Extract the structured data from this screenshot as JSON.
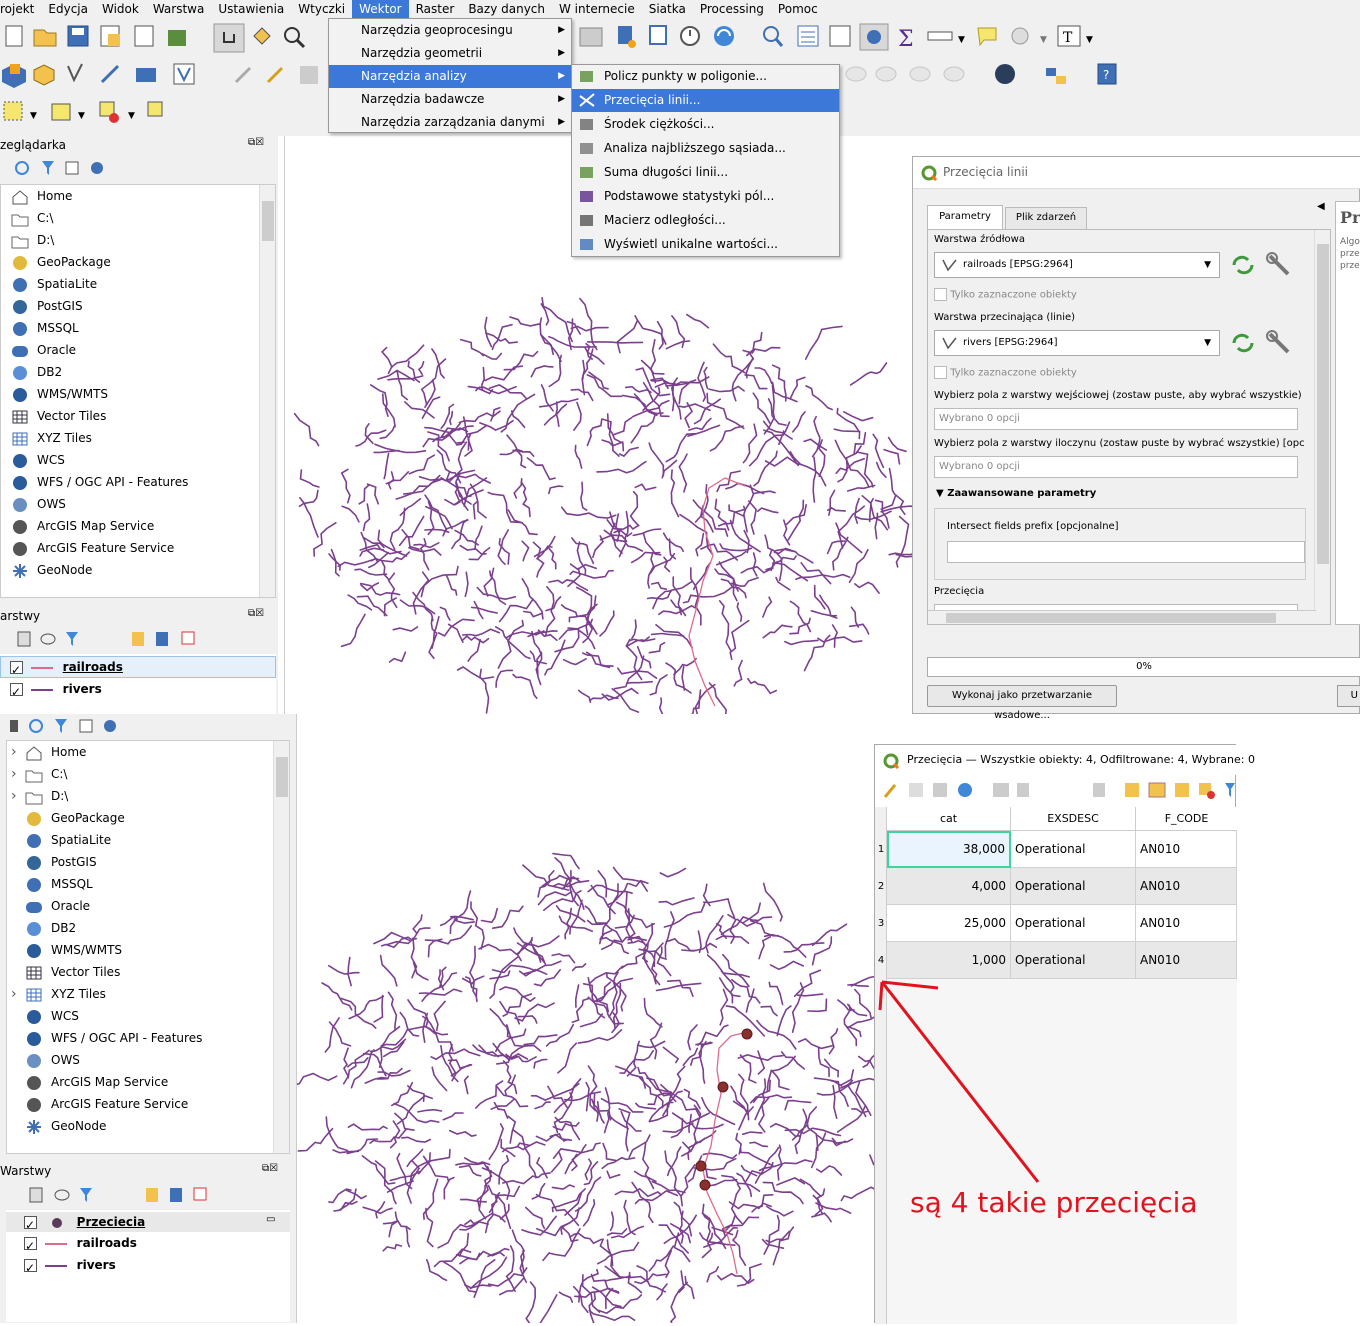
{
  "menubar": [
    "rojekt",
    "Edycja",
    "Widok",
    "Warstwa",
    "Ustawienia",
    "Wtyczki",
    "Wektor",
    "Raster",
    "Bazy danych",
    "W internecie",
    "Siatka",
    "Processing",
    "Pomoc"
  ],
  "vector_menu": [
    "Narzędzia geoprocesingu",
    "Narzędzia geometrii",
    "Narzędzia analizy",
    "Narzędzia badawcze",
    "Narzędzia zarządzania danymi"
  ],
  "analysis_menu": [
    "Policz punkty w poligonie...",
    "Przecięcia linii...",
    "Środek ciężkości...",
    "Analiza najbliższego sąsiada...",
    "Suma długości linii...",
    "Podstawowe statystyki pól...",
    "Macierz odległości...",
    "Wyświetl unikalne wartości..."
  ],
  "browser_top": {
    "title": "zeglądarka",
    "items": [
      "Home",
      "C:\\",
      "D:\\",
      "GeoPackage",
      "SpatiaLite",
      "PostGIS",
      "MSSQL",
      "Oracle",
      "DB2",
      "WMS/WMTS",
      "Vector Tiles",
      "XYZ Tiles",
      "WCS",
      "WFS / OGC API - Features",
      "OWS",
      "ArcGIS Map Service",
      "ArcGIS Feature Service",
      "GeoNode"
    ]
  },
  "layers_top": {
    "title": "arstwy",
    "items": [
      "railroads",
      "rivers"
    ]
  },
  "browser_bottom": {
    "items": [
      "Home",
      "C:\\",
      "D:\\",
      "GeoPackage",
      "SpatiaLite",
      "PostGIS",
      "MSSQL",
      "Oracle",
      "DB2",
      "WMS/WMTS",
      "Vector Tiles",
      "XYZ Tiles",
      "WCS",
      "WFS / OGC API - Features",
      "OWS",
      "ArcGIS Map Service",
      "ArcGIS Feature Service",
      "GeoNode"
    ]
  },
  "layers_bottom": {
    "title": "Warstwy",
    "items": [
      "Przeciecia",
      "railroads",
      "rivers"
    ]
  },
  "dialog": {
    "title": "Przecięcia linii",
    "tabs": [
      "Parametry",
      "Plik zdarzeń"
    ],
    "source_label": "Warstwa źródłowa",
    "source_value": "railroads [EPSG:2964]",
    "selected_only": "Tylko zaznaczone obiekty",
    "intersect_label": "Warstwa przecinająca (linie)",
    "intersect_value": "rivers [EPSG:2964]",
    "fields_input_label": "Wybierz pola z warstwy wejściowej (zostaw puste, aby wybrać wszystkie) [opcjo",
    "fields_overlay_label": "Wybierz pola z warstwy iloczynu (zostaw puste by wybrać wszystkie) [opcjonalne",
    "fields_placeholder": "Wybrano 0 opcji",
    "advanced": "Zaawansowane parametry",
    "prefix_label": "Intersect fields prefix [opcjonalne]",
    "output_label": "Przecięcia",
    "progress": "0%",
    "batch_button": "Wykonaj jako przetwarzanie wsadowe...",
    "help_title": "Prz",
    "help_text": [
      "Algo",
      "prze",
      "prze"
    ],
    "right_btn": "U"
  },
  "attr_table": {
    "title": "Przecięcia — Wszystkie obiekty: 4, Odfiltrowane: 4, Wybrane: 0",
    "columns": [
      "cat",
      "EXSDESC",
      "F_CODE"
    ],
    "rows": [
      {
        "n": "1",
        "cat": "38,000",
        "desc": "Operational",
        "code": "AN010"
      },
      {
        "n": "2",
        "cat": "4,000",
        "desc": "Operational",
        "code": "AN010"
      },
      {
        "n": "3",
        "cat": "25,000",
        "desc": "Operational",
        "code": "AN010"
      },
      {
        "n": "4",
        "cat": "1,000",
        "desc": "Operational",
        "code": "AN010"
      }
    ]
  },
  "annotation": "są 4 takie przecięcia",
  "colors": {
    "river": "#7b3f8e",
    "railroad": "#e06a8a",
    "point": "#8b2e2e",
    "highlight": "#3c78d8",
    "annotation": "#e0141e"
  }
}
